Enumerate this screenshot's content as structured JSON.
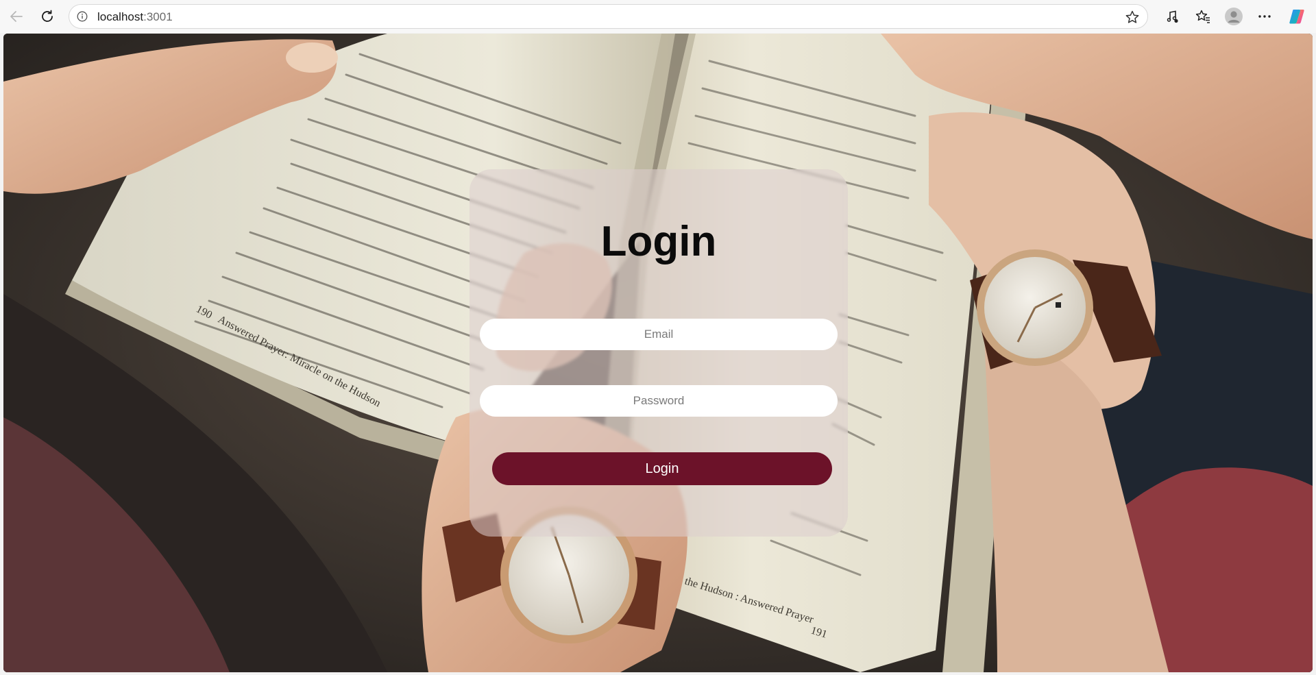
{
  "browser": {
    "url_host": "localhost",
    "url_port": ":3001"
  },
  "login": {
    "title": "Login",
    "email_placeholder": "Email",
    "password_placeholder": "Password",
    "submit_label": "Login",
    "accent_color": "#6c1229"
  },
  "background": {
    "book_left_page_number": "190",
    "book_left_running_head": "Answered Prayer: Miracle on the Hudson",
    "book_right_page_number": "191",
    "book_right_running_head": "the Hudson : Answered Prayer"
  },
  "icons": [
    "back-arrow-icon",
    "reload-icon",
    "info-icon",
    "star-icon",
    "music-note-icon",
    "favorites-icon",
    "profile-icon",
    "more-icon",
    "copilot-icon"
  ]
}
